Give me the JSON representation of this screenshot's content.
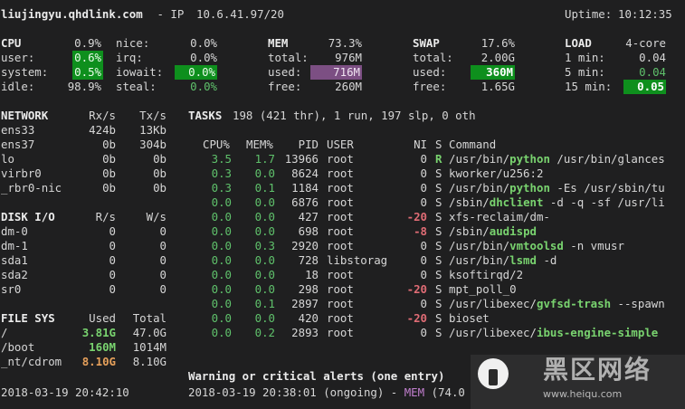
{
  "header": {
    "host": "liujingyu.qhdlink.com",
    "ip_label": " - IP ",
    "ip": "10.6.41.97/20",
    "uptime_label": "Uptime:",
    "uptime": "10:12:35"
  },
  "cpu": {
    "title": "CPU",
    "total": "0.9%",
    "user_l": "user:",
    "user": "0.6%",
    "system_l": "system:",
    "system": "0.5%",
    "idle_l": "idle:",
    "idle": "98.9%",
    "nice_l": "nice:",
    "nice": "0.0%",
    "irq_l": "irq:",
    "irq": "0.0%",
    "iowait_l": "iowait:",
    "iowait": "0.0%",
    "steal_l": "steal:",
    "steal": "0.0%"
  },
  "mem": {
    "title": "MEM",
    "pct": "73.3%",
    "total_l": "total:",
    "total": "976M",
    "used_l": "used:",
    "used": "716M",
    "free_l": "free:",
    "free": "260M"
  },
  "swap": {
    "title": "SWAP",
    "pct": "17.6%",
    "total_l": "total:",
    "total": "2.00G",
    "used_l": "used:",
    "used": "360M",
    "free_l": "free:",
    "free": "1.65G"
  },
  "load": {
    "title": "LOAD",
    "cores": "4-core",
    "m1_l": "1 min:",
    "m1": "0.04",
    "m5_l": "5 min:",
    "m5": "0.04",
    "m15_l": "15 min:",
    "m15": "0.05"
  },
  "network": {
    "title": "NETWORK",
    "rx": "Rx/s",
    "tx": "Tx/s",
    "rows": [
      {
        "name": "ens33",
        "rx": "424b",
        "tx": "13Kb"
      },
      {
        "name": "ens37",
        "rx": "0b",
        "tx": "304b"
      },
      {
        "name": "lo",
        "rx": "0b",
        "tx": "0b"
      },
      {
        "name": "virbr0",
        "rx": "0b",
        "tx": "0b"
      },
      {
        "name": "_rbr0-nic",
        "rx": "0b",
        "tx": "0b"
      }
    ]
  },
  "disk": {
    "title": "DISK I/O",
    "r": "R/s",
    "w": "W/s",
    "rows": [
      {
        "name": "dm-0",
        "r": "0",
        "w": "0"
      },
      {
        "name": "dm-1",
        "r": "0",
        "w": "0"
      },
      {
        "name": "sda1",
        "r": "0",
        "w": "0"
      },
      {
        "name": "sda2",
        "r": "0",
        "w": "0"
      },
      {
        "name": "sr0",
        "r": "0",
        "w": "0"
      }
    ]
  },
  "fs": {
    "title": "FILE SYS",
    "used": "Used",
    "total": "Total",
    "rows": [
      {
        "name": "/",
        "used": "3.81G",
        "total": "47.0G"
      },
      {
        "name": "/boot",
        "used": "160M",
        "total": "1014M"
      },
      {
        "name": "_nt/cdrom",
        "used": "8.10G",
        "total": "8.10G"
      }
    ]
  },
  "tasks": {
    "title": "TASKS",
    "summary": "198 (421 thr), 1 run, 197 slp, 0 oth"
  },
  "proc": {
    "headers": {
      "cpu": "CPU%",
      "mem": "MEM%",
      "pid": "PID",
      "user": "USER",
      "ni": "NI",
      "s": "S",
      "cmd": "Command"
    },
    "rows": [
      {
        "cpu": "3.5",
        "mem": "1.7",
        "pid": "13966",
        "user": "root",
        "ni": "0",
        "s": "R",
        "cmd_a": "/usr/bin/",
        "cmd_b": "python",
        "cmd_c": " /usr/bin/glances"
      },
      {
        "cpu": "0.3",
        "mem": "0.0",
        "pid": "8624",
        "user": "root",
        "ni": "0",
        "s": "S",
        "cmd_a": "kworker/u256:2",
        "cmd_b": "",
        "cmd_c": ""
      },
      {
        "cpu": "0.3",
        "mem": "0.1",
        "pid": "1184",
        "user": "root",
        "ni": "0",
        "s": "S",
        "cmd_a": "/usr/bin/",
        "cmd_b": "python",
        "cmd_c": " -Es /usr/sbin/tu"
      },
      {
        "cpu": "0.0",
        "mem": "0.0",
        "pid": "6876",
        "user": "root",
        "ni": "0",
        "s": "S",
        "cmd_a": "/sbin/",
        "cmd_b": "dhclient",
        "cmd_c": " -d -q -sf /usr/li"
      },
      {
        "cpu": "0.0",
        "mem": "0.0",
        "pid": "427",
        "user": "root",
        "ni": "-20",
        "s": "S",
        "cmd_a": "xfs-reclaim/dm-",
        "cmd_b": "",
        "cmd_c": ""
      },
      {
        "cpu": "0.0",
        "mem": "0.0",
        "pid": "698",
        "user": "root",
        "ni": "-8",
        "s": "S",
        "cmd_a": "/sbin/",
        "cmd_b": "audispd",
        "cmd_c": ""
      },
      {
        "cpu": "0.0",
        "mem": "0.3",
        "pid": "2920",
        "user": "root",
        "ni": "0",
        "s": "S",
        "cmd_a": "/usr/bin/",
        "cmd_b": "vmtoolsd",
        "cmd_c": " -n vmusr"
      },
      {
        "cpu": "0.0",
        "mem": "0.0",
        "pid": "728",
        "user": "libstorag",
        "ni": "0",
        "s": "S",
        "cmd_a": "/usr/bin/",
        "cmd_b": "lsmd",
        "cmd_c": " -d"
      },
      {
        "cpu": "0.0",
        "mem": "0.0",
        "pid": "18",
        "user": "root",
        "ni": "0",
        "s": "S",
        "cmd_a": "ksoftirqd/2",
        "cmd_b": "",
        "cmd_c": ""
      },
      {
        "cpu": "0.0",
        "mem": "0.0",
        "pid": "298",
        "user": "root",
        "ni": "-20",
        "s": "S",
        "cmd_a": "mpt_poll_0",
        "cmd_b": "",
        "cmd_c": ""
      },
      {
        "cpu": "0.0",
        "mem": "0.1",
        "pid": "2897",
        "user": "root",
        "ni": "0",
        "s": "S",
        "cmd_a": "/usr/libexec/",
        "cmd_b": "gvfsd-trash",
        "cmd_c": " --spawn"
      },
      {
        "cpu": "0.0",
        "mem": "0.0",
        "pid": "420",
        "user": "root",
        "ni": "-20",
        "s": "S",
        "cmd_a": "bioset",
        "cmd_b": "",
        "cmd_c": ""
      },
      {
        "cpu": "0.0",
        "mem": "0.2",
        "pid": "2893",
        "user": "root",
        "ni": "0",
        "s": "S",
        "cmd_a": "/usr/libexec/",
        "cmd_b": "ibus-engine-simple",
        "cmd_c": ""
      }
    ]
  },
  "alerts": {
    "title": "Warning or critical alerts (one entry)",
    "time": "2018-03-19 20:38:01 (ongoing) - ",
    "key": "MEM",
    "tail": " (74.0"
  },
  "footer": {
    "datetime": "2018-03-19 20:42:10"
  },
  "watermark": {
    "cn": "黑区网络",
    "url": "www.heiqu.com"
  }
}
